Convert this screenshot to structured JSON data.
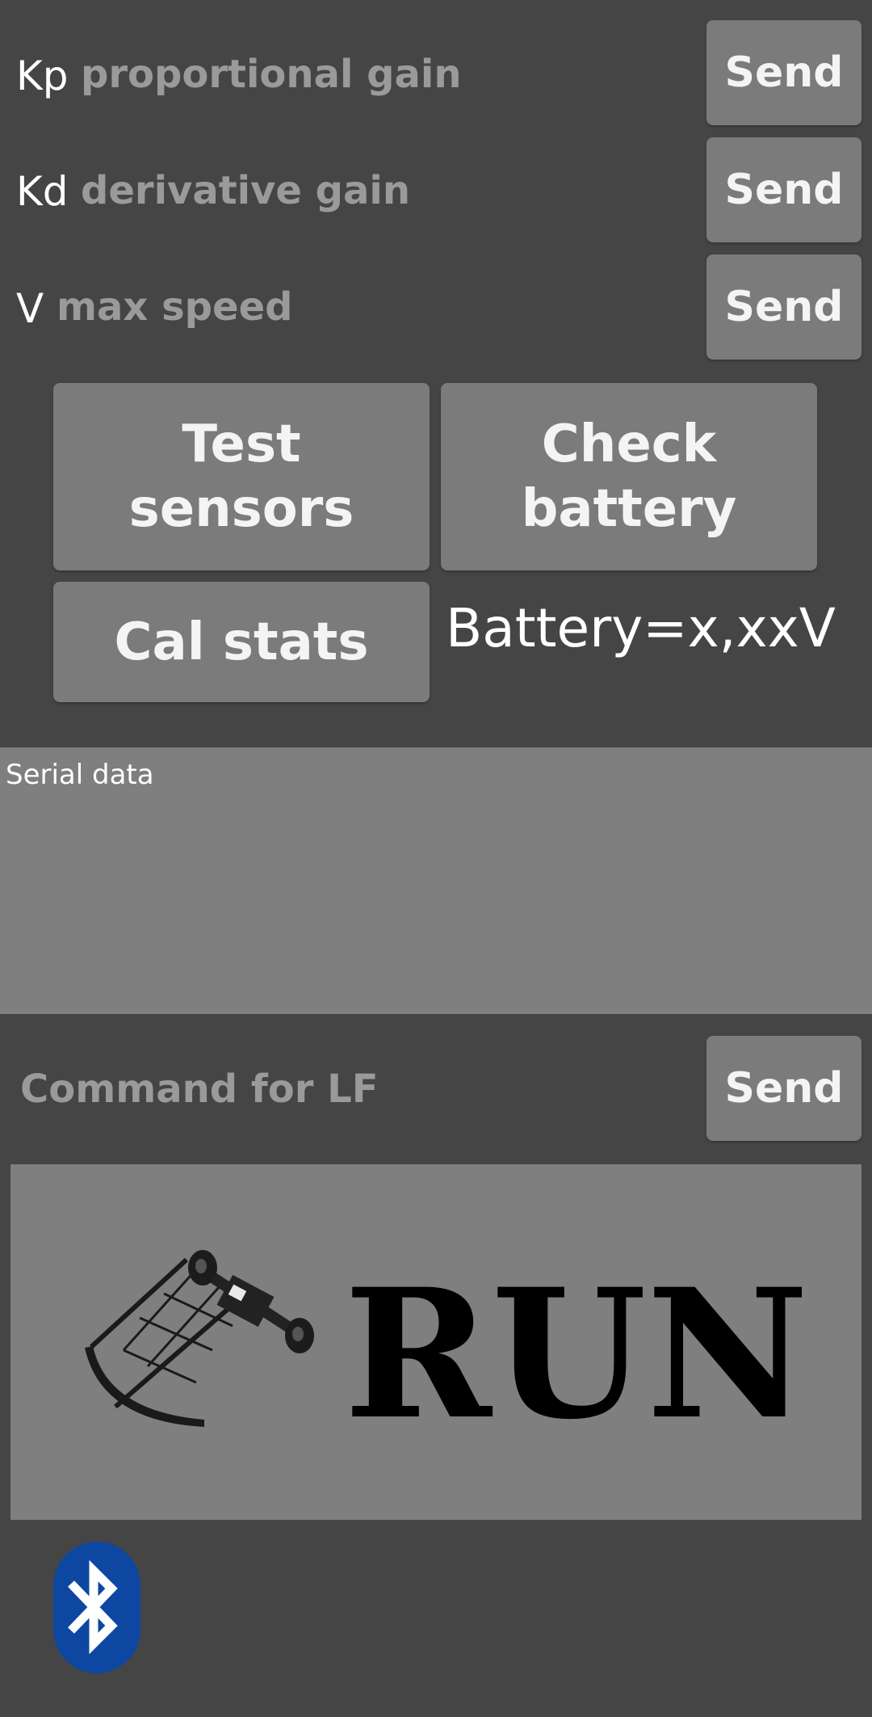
{
  "params": [
    {
      "label": "Kp",
      "placeholder": "proportional gain",
      "send_label": "Send"
    },
    {
      "label": "Kd",
      "placeholder": "derivative gain",
      "send_label": "Send"
    },
    {
      "label": "V",
      "placeholder": "max speed",
      "send_label": "Send"
    }
  ],
  "buttons": {
    "test_sensors_line1": "Test",
    "test_sensors_line2": "sensors",
    "check_battery_line1": "Check",
    "check_battery_line2": "battery",
    "cal_stats": "Cal stats"
  },
  "battery_status": "Battery=x,xxV",
  "serial": {
    "label": "Serial data"
  },
  "command": {
    "placeholder": "Command for LF",
    "send_label": "Send"
  },
  "run_button": {
    "text": "RUN"
  },
  "icons": {
    "bluetooth": "bluetooth-icon",
    "robot": "line-follower-robot-image"
  },
  "colors": {
    "background": "#454545",
    "button": "#7b7b7b",
    "panel": "#7f7f7f",
    "placeholder": "#9a9a9a",
    "bluetooth": "#0d47a1"
  }
}
